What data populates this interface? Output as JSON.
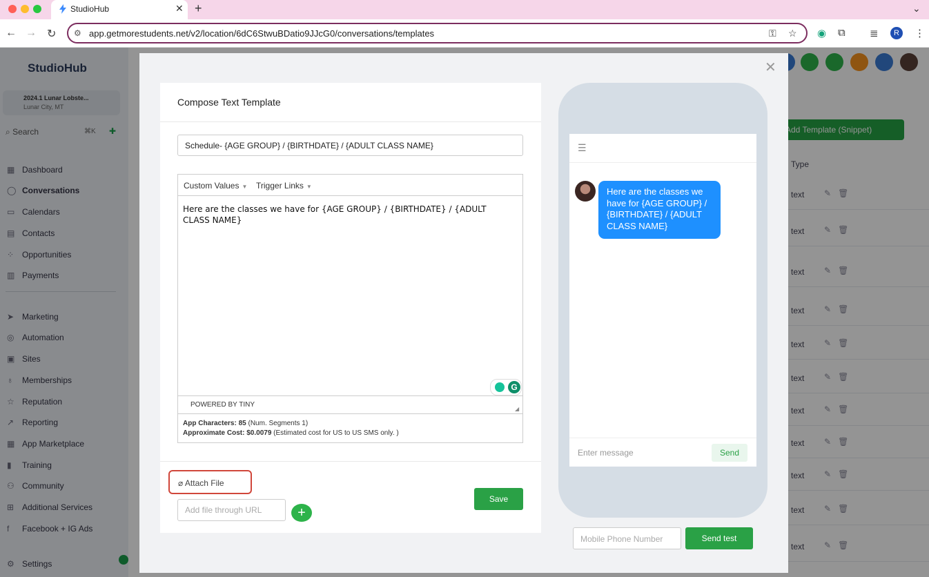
{
  "browser": {
    "tab_title": "StudioHub",
    "url": "app.getmorestudents.net/v2/location/6dC6StwuBDatio9JJcG0/conversations/templates",
    "profile_initial": "R"
  },
  "sidebar": {
    "logo": "StudioHub",
    "location_name": "2024.1 Lunar Lobste...",
    "location_city": "Lunar City, MT",
    "search_label": "Search",
    "search_shortcut": "⌘K",
    "items": [
      {
        "label": "Dashboard",
        "icon": "dashboard-icon",
        "glyph": "▦"
      },
      {
        "label": "Conversations",
        "icon": "chat-icon",
        "glyph": "◯"
      },
      {
        "label": "Calendars",
        "icon": "calendar-icon",
        "glyph": "▭"
      },
      {
        "label": "Contacts",
        "icon": "contacts-icon",
        "glyph": "▤"
      },
      {
        "label": "Opportunities",
        "icon": "opportunities-icon",
        "glyph": "⁘"
      },
      {
        "label": "Payments",
        "icon": "payments-icon",
        "glyph": "▥"
      },
      {
        "label": "Marketing",
        "icon": "marketing-icon",
        "glyph": "➤"
      },
      {
        "label": "Automation",
        "icon": "automation-icon",
        "glyph": "◎"
      },
      {
        "label": "Sites",
        "icon": "sites-icon",
        "glyph": "▣"
      },
      {
        "label": "Memberships",
        "icon": "memberships-icon",
        "glyph": "♁"
      },
      {
        "label": "Reputation",
        "icon": "star-icon",
        "glyph": "☆"
      },
      {
        "label": "Reporting",
        "icon": "reporting-icon",
        "glyph": "↗"
      },
      {
        "label": "App Marketplace",
        "icon": "marketplace-icon",
        "glyph": "▦"
      },
      {
        "label": "Training",
        "icon": "book-icon",
        "glyph": "▮"
      },
      {
        "label": "Community",
        "icon": "community-icon",
        "glyph": "⚇"
      },
      {
        "label": "Additional Services",
        "icon": "cart-icon",
        "glyph": "⊞"
      },
      {
        "label": "Facebook + IG Ads",
        "icon": "facebook-icon",
        "glyph": "f"
      },
      {
        "label": "Settings",
        "icon": "gear-icon",
        "glyph": "⚙"
      }
    ]
  },
  "main": {
    "add_button": "Add Template (Snippet)",
    "type_header": "Type",
    "row_type": "text"
  },
  "modal": {
    "title": "Compose Text Template",
    "template_name": "Schedule- {AGE GROUP} / {BIRTHDATE} / {ADULT CLASS NAME}",
    "editor_menus": [
      "Custom Values",
      "Trigger Links"
    ],
    "body_text": "Here are the classes we have for {AGE GROUP} / {BIRTHDATE} / {ADULT CLASS NAME}",
    "powered_by": "POWERED BY TINY",
    "characters_label": "App Characters:",
    "characters_value": "85",
    "segments_note": "(Num. Segments 1)",
    "cost_label": "Approximate Cost:",
    "cost_value": "$0.0079",
    "cost_note": "(Estimated cost for US to US SMS only. )",
    "attach_label": "Attach File",
    "url_placeholder": "Add file through URL",
    "save_label": "Save",
    "preview": {
      "message": "Here are the classes we have for {AGE GROUP} / {BIRTHDATE} / {ADULT CLASS NAME}",
      "input_placeholder": "Enter message",
      "send_label": "Send"
    },
    "phone_placeholder": "Mobile Phone Number",
    "send_test_label": "Send test"
  },
  "colors": {
    "accent_green": "#2aa146",
    "bubble_blue": "#1e90ff",
    "highlight_red": "#d0463a",
    "tab_strip_pink": "#f6d6e9"
  }
}
